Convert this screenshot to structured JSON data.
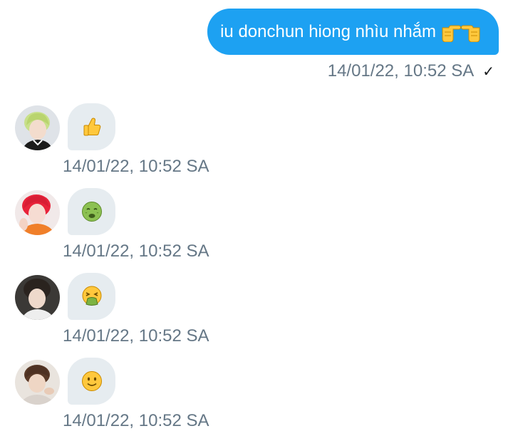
{
  "outgoing": {
    "text": "iu donchun hiong nhìu nhắm",
    "emoji": [
      "pointing-right-hand-icon",
      "pointing-left-hand-icon"
    ],
    "timestamp": "14/01/22, 10:52 SA",
    "status_icon": "check-icon",
    "status_glyph": "✓",
    "bubble_color": "#1da1f2"
  },
  "incoming": [
    {
      "emoji": "thumbs-up-icon",
      "timestamp": "14/01/22, 10:52 SA"
    },
    {
      "emoji": "nauseated-face-icon",
      "timestamp": "14/01/22, 10:52 SA"
    },
    {
      "emoji": "vomiting-face-icon",
      "timestamp": "14/01/22, 10:52 SA"
    },
    {
      "emoji": "slightly-smiling-face-icon",
      "timestamp": "14/01/22, 10:52 SA"
    }
  ],
  "colors": {
    "meta_text": "#657786",
    "incoming_bubble": "#e6ecf0"
  }
}
